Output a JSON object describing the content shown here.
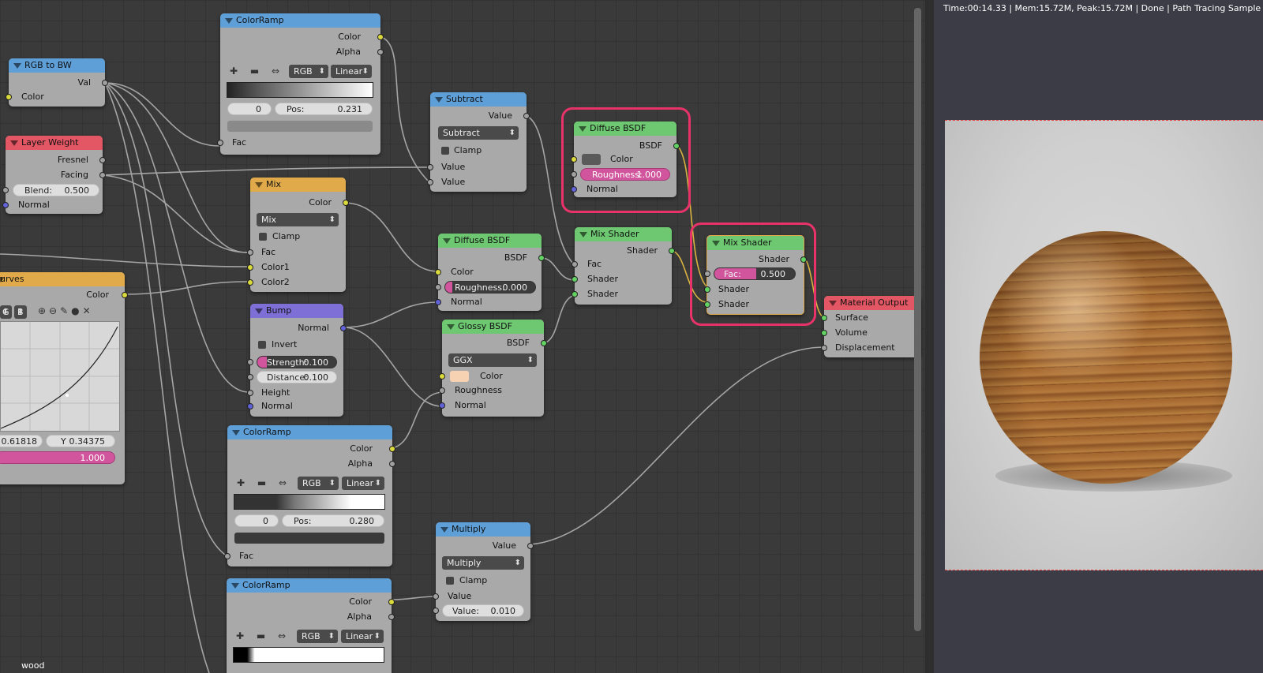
{
  "status": "Time:00:14.33 | Mem:15.72M, Peak:15.72M | Done | Path Tracing Sample 144/144",
  "editor_label": "wood",
  "nodes": {
    "colorramp1": {
      "title": "ColorRamp",
      "out_color": "Color",
      "out_alpha": "Alpha",
      "mode": "RGB",
      "interp": "Linear",
      "index": "0",
      "pos_label": "Pos:",
      "pos_value": "0.231",
      "in_fac": "Fac"
    },
    "rgbtobw": {
      "title": "RGB to BW",
      "out_val": "Val",
      "in_color": "Color"
    },
    "layerweight": {
      "title": "Layer Weight",
      "out_fresnel": "Fresnel",
      "out_facing": "Facing",
      "blend_label": "Blend:",
      "blend_value": "0.500",
      "in_normal": "Normal"
    },
    "subtract": {
      "title": "Subtract",
      "out_value": "Value",
      "op": "Subtract",
      "clamp": "Clamp",
      "in_value1": "Value",
      "in_value2": "Value"
    },
    "mix": {
      "title": "Mix",
      "out_color": "Color",
      "blend": "Mix",
      "clamp": "Clamp",
      "in_fac": "Fac",
      "in_color1": "Color1",
      "in_color2": "Color2"
    },
    "curves": {
      "title": "urves",
      "out_color": "Color",
      "tab_g": "G",
      "tab_b": "B",
      "x_value": "0.61818",
      "y_label": "Y",
      "y_value": "0.34375",
      "fac_value": "1.000"
    },
    "bump": {
      "title": "Bump",
      "out_normal": "Normal",
      "invert": "Invert",
      "strength_label": "Strength:",
      "strength_value": "0.100",
      "distance_label": "Distance:",
      "distance_value": "0.100",
      "in_height": "Height",
      "in_normal": "Normal"
    },
    "diffuse1": {
      "title": "Diffuse BSDF",
      "out_bsdf": "BSDF",
      "in_color": "Color",
      "rough_label": "Roughness:",
      "rough_value": "1.000",
      "in_normal": "Normal"
    },
    "diffuse2": {
      "title": "Diffuse BSDF",
      "out_bsdf": "BSDF",
      "in_color": "Color",
      "rough_label": "Roughness:",
      "rough_value": "0.000",
      "in_normal": "Normal"
    },
    "glossy": {
      "title": "Glossy BSDF",
      "out_bsdf": "BSDF",
      "dist": "GGX",
      "in_color": "Color",
      "in_roughness": "Roughness",
      "in_normal": "Normal"
    },
    "mixshader1": {
      "title": "Mix Shader",
      "out_shader": "Shader",
      "in_fac": "Fac",
      "in_shader1": "Shader",
      "in_shader2": "Shader"
    },
    "mixshader2": {
      "title": "Mix Shader",
      "out_shader": "Shader",
      "fac_label": "Fac:",
      "fac_value": "0.500",
      "in_shader1": "Shader",
      "in_shader2": "Shader"
    },
    "output": {
      "title": "Material Output",
      "in_surface": "Surface",
      "in_volume": "Volume",
      "in_displacement": "Displacement"
    },
    "colorramp2": {
      "title": "ColorRamp",
      "out_color": "Color",
      "out_alpha": "Alpha",
      "mode": "RGB",
      "interp": "Linear",
      "index": "0",
      "pos_label": "Pos:",
      "pos_value": "0.280",
      "in_fac": "Fac"
    },
    "multiply": {
      "title": "Multiply",
      "out_value": "Value",
      "op": "Multiply",
      "clamp": "Clamp",
      "in_value": "Value",
      "value_label": "Value:",
      "value_value": "0.010"
    },
    "colorramp3": {
      "title": "ColorRamp",
      "out_color": "Color",
      "out_alpha": "Alpha",
      "mode": "RGB",
      "interp": "Linear"
    }
  },
  "colors": {
    "highlight": "#e8336a",
    "glossy_swatch": "#f7d2b2",
    "diffuse_swatch": "#5a5a5a"
  }
}
